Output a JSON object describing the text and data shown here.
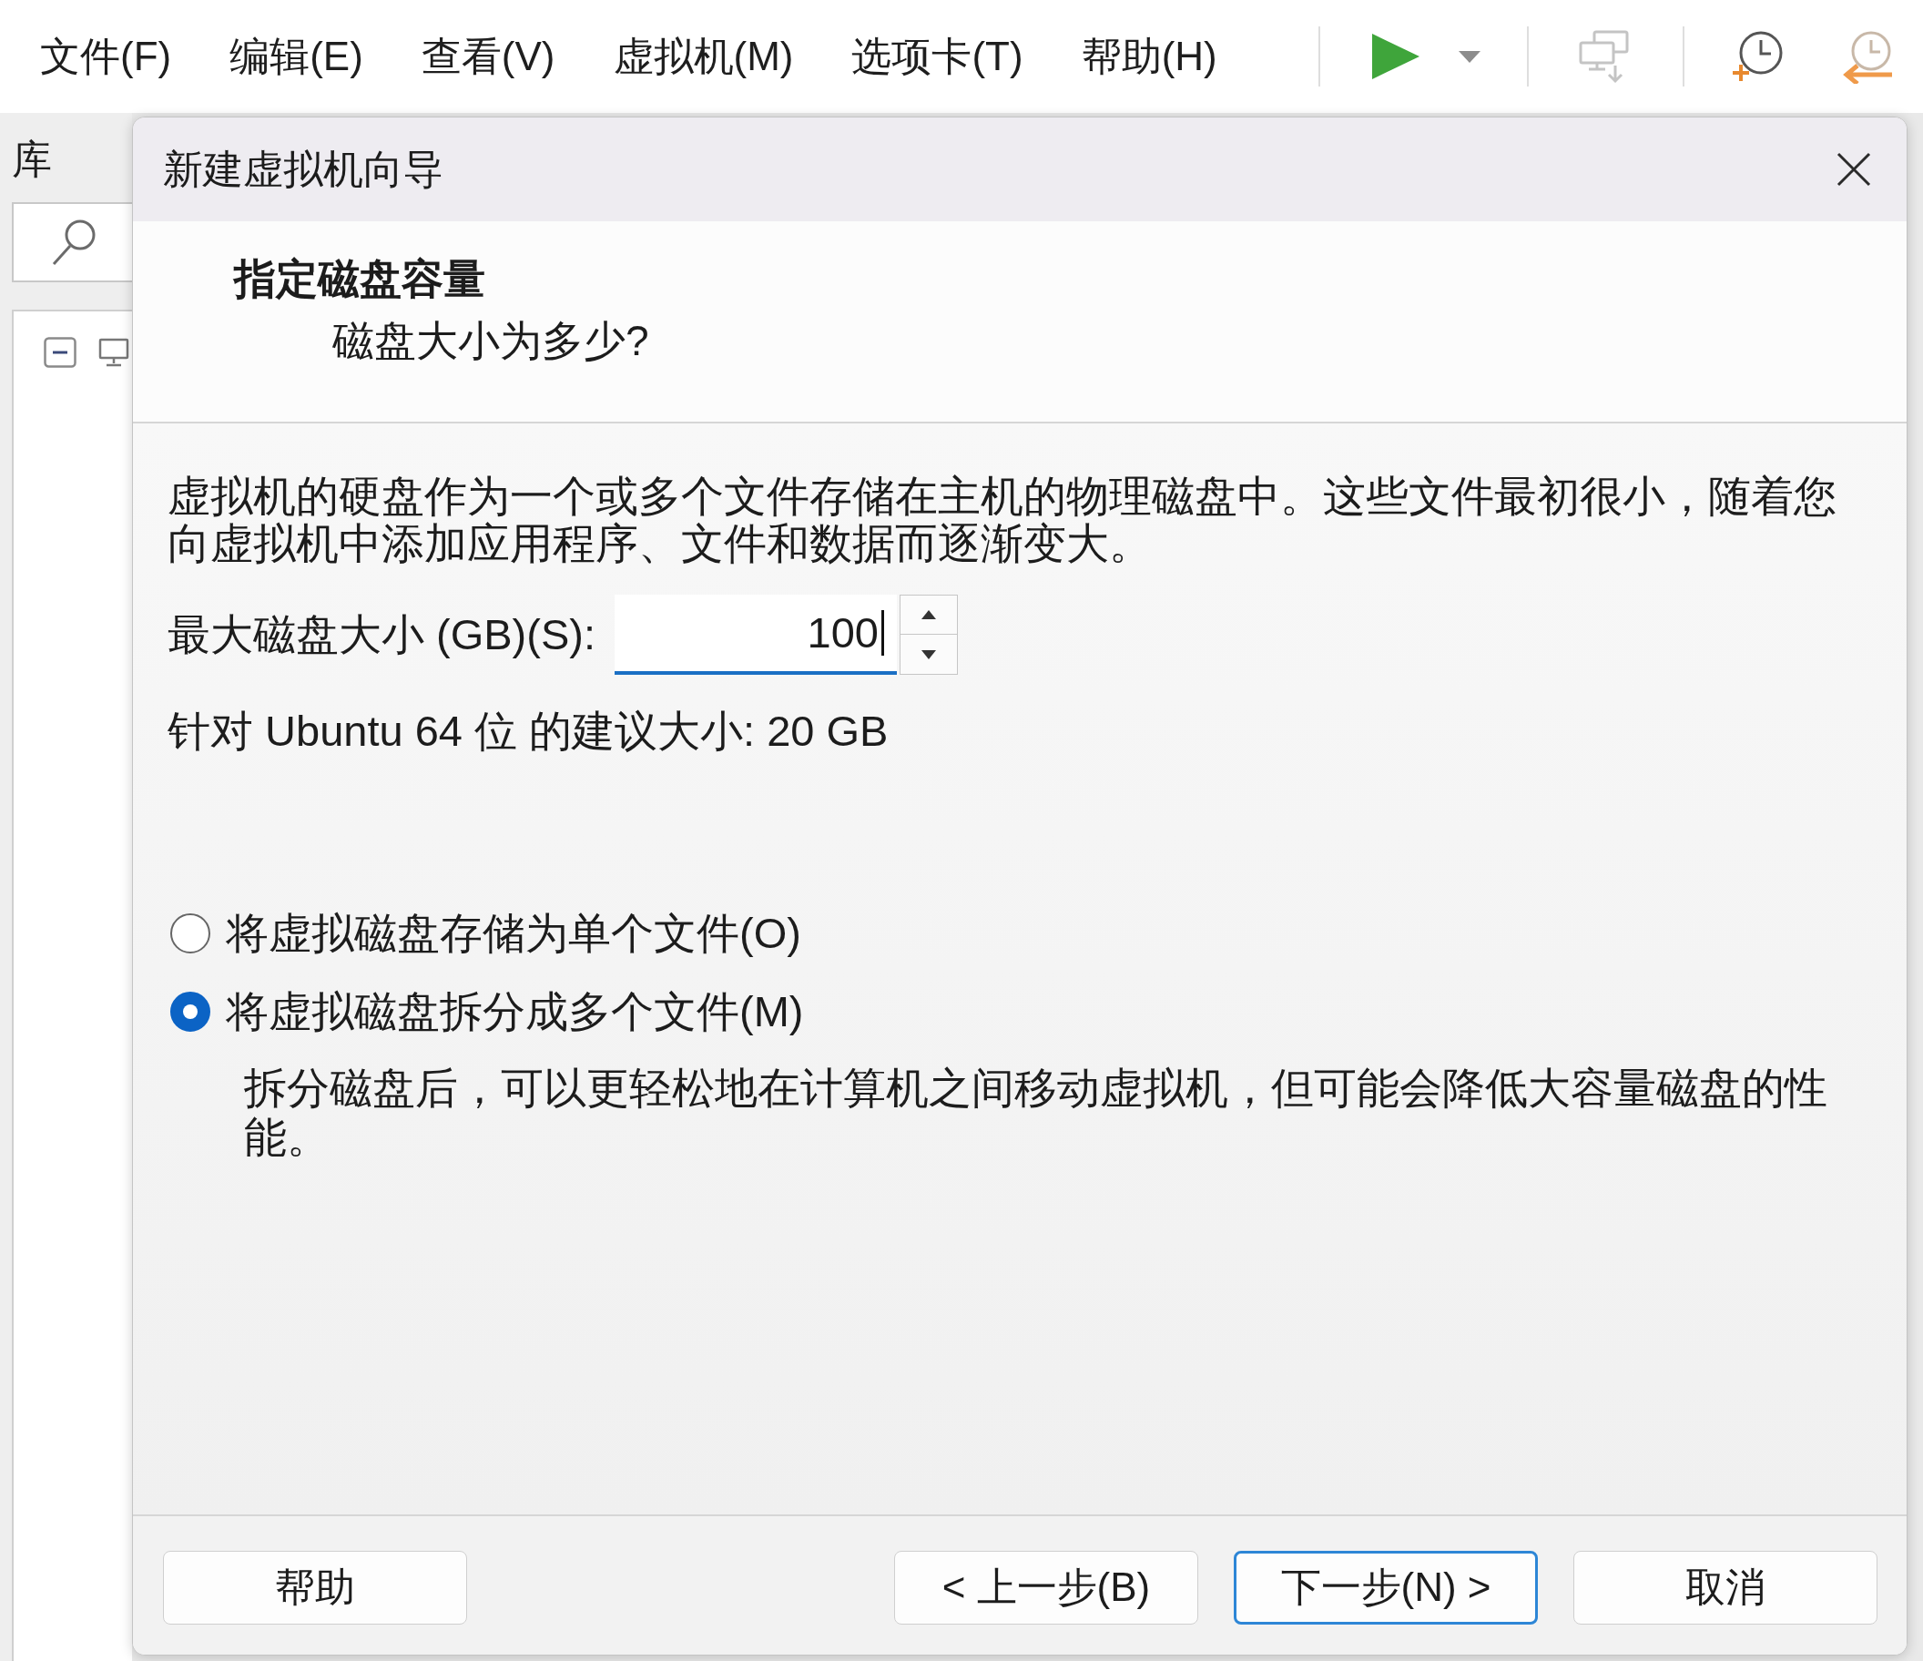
{
  "menu_bar": [
    "文件(F)",
    "编辑(E)",
    "查看(V)",
    "虚拟机(M)",
    "选项卡(T)",
    "帮助(H)"
  ],
  "toolbar": [
    {
      "disabled": false,
      "dropdown": true
    },
    {
      "disabled": true
    },
    {
      "disabled": false
    },
    {
      "disabled": false
    }
  ],
  "library": {
    "title": "库",
    "tree": [
      {
        "expanded": true
      }
    ]
  },
  "dialog": {
    "title": "新建虚拟机向导",
    "header": {
      "title": "指定磁盘容量",
      "subtitle": "磁盘大小为多少?"
    },
    "description": "虚拟机的硬盘作为一个或多个文件存储在主机的物理磁盘中。这些文件最初很小，随着您向虚拟机中添加应用程序、文件和数据而逐渐变大。",
    "disk_size": {
      "label": "最大磁盘大小 (GB)(S):",
      "value": "100",
      "focused": true
    },
    "recommendation": "针对 Ubuntu 64 位 的建议大小: 20 GB",
    "storage_options": [
      {
        "label": "将虚拟磁盘存储为单个文件(O)",
        "selected": false
      },
      {
        "label": "将虚拟磁盘拆分成多个文件(M)",
        "selected": true,
        "note": "拆分磁盘后，可以更轻松地在计算机之间移动虚拟机，但可能会降低大容量磁盘的性能。"
      }
    ],
    "buttons": [
      {
        "label": "帮助",
        "default": false
      },
      {
        "label": "< 上一步(B)",
        "default": false
      },
      {
        "label": "下一步(N) >",
        "default": true
      },
      {
        "label": "取消",
        "default": false
      }
    ]
  }
}
